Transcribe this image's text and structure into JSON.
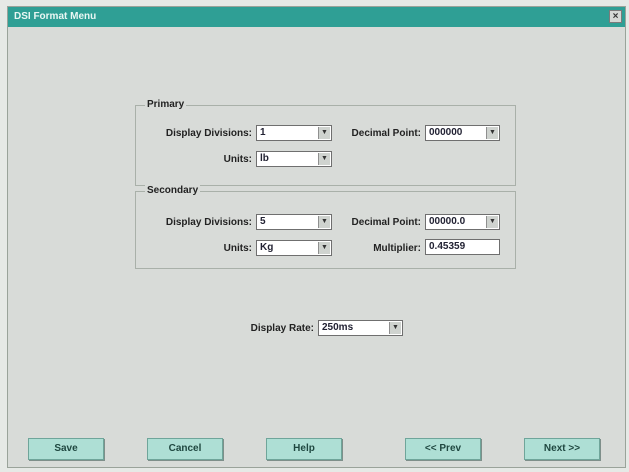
{
  "window": {
    "title": "DSI Format Menu",
    "close_label": "×"
  },
  "primary": {
    "title": "Primary",
    "display_divisions_label": "Display Divisions:",
    "display_divisions_value": "1",
    "decimal_point_label": "Decimal Point:",
    "decimal_point_value": "000000",
    "units_label": "Units:",
    "units_value": "lb"
  },
  "secondary": {
    "title": "Secondary",
    "display_divisions_label": "Display Divisions:",
    "display_divisions_value": "5",
    "decimal_point_label": "Decimal Point:",
    "decimal_point_value": "00000.0",
    "units_label": "Units:",
    "units_value": "Kg",
    "multiplier_label": "Multiplier:",
    "multiplier_value": "0.45359"
  },
  "display_rate": {
    "label": "Display Rate:",
    "value": "250ms"
  },
  "buttons": {
    "save": "Save",
    "cancel": "Cancel",
    "help": "Help",
    "prev": "<< Prev",
    "next": "Next >>"
  },
  "icons": {
    "dropdown_arrow": "▼"
  },
  "colors": {
    "titlebar": "#2f9f95",
    "button": "#aedfd5"
  }
}
